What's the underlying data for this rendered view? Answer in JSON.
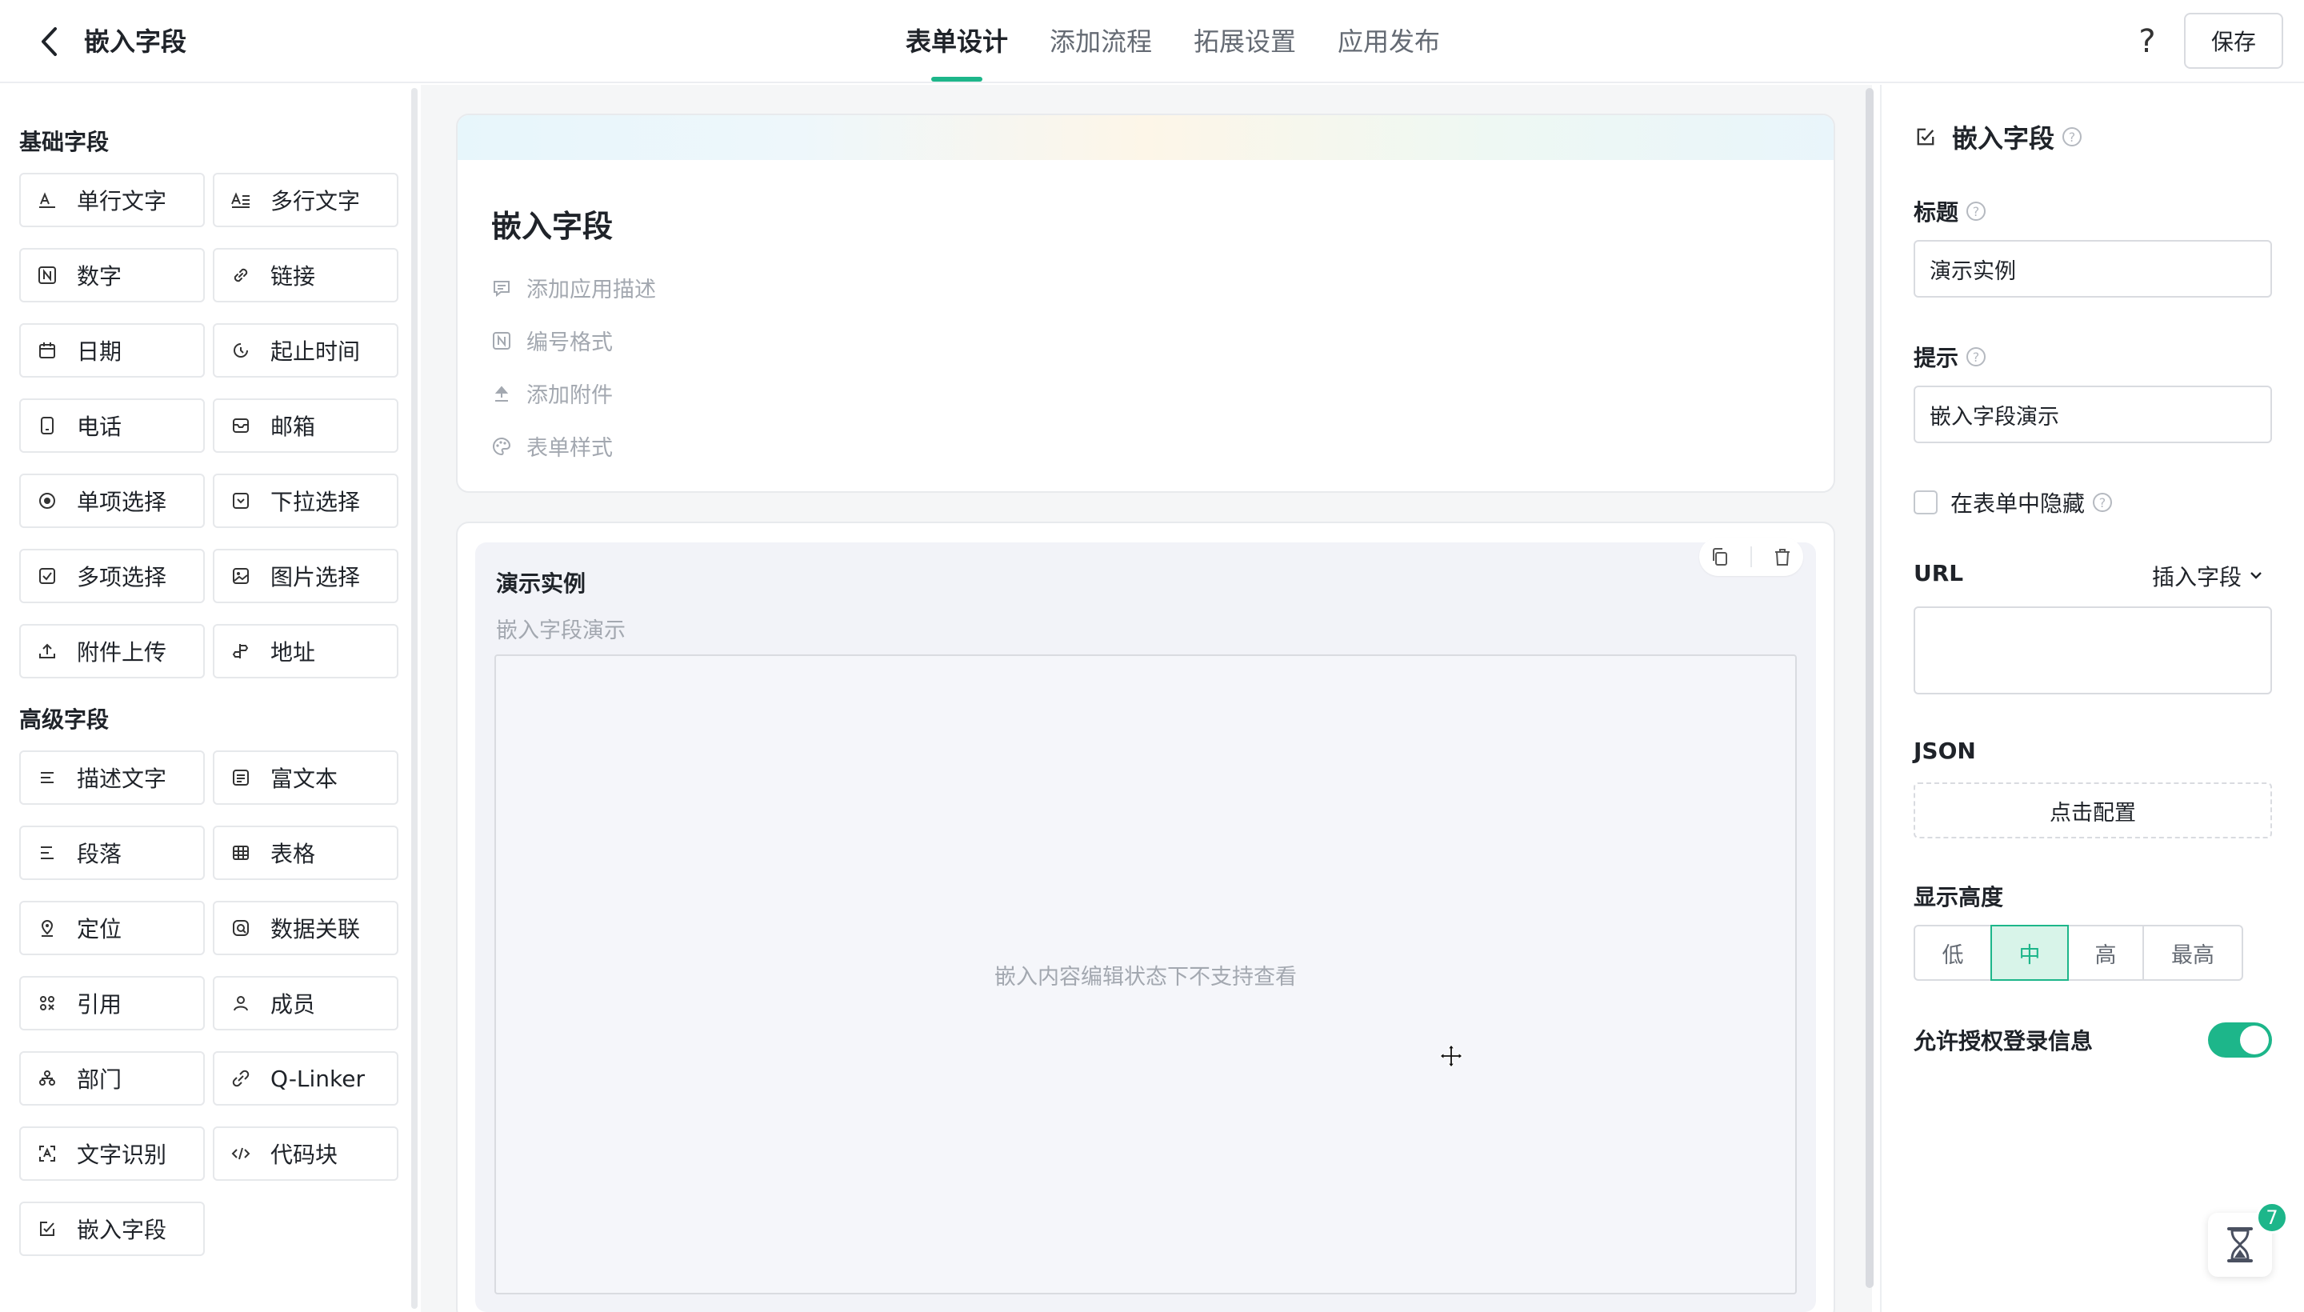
{
  "header": {
    "back_icon": "chevron-left-icon",
    "title": "嵌入字段",
    "tabs": [
      {
        "label": "表单设计",
        "active": true
      },
      {
        "label": "添加流程",
        "active": false
      },
      {
        "label": "拓展设置",
        "active": false
      },
      {
        "label": "应用发布",
        "active": false
      }
    ],
    "help_label": "?",
    "save_label": "保存"
  },
  "sidebar": {
    "basic_title": "基础字段",
    "basic_items": [
      {
        "label": "单行文字",
        "icon": "single-line-text-icon"
      },
      {
        "label": "多行文字",
        "icon": "multi-line-text-icon"
      },
      {
        "label": "数字",
        "icon": "number-icon"
      },
      {
        "label": "链接",
        "icon": "link-icon"
      },
      {
        "label": "日期",
        "icon": "calendar-icon"
      },
      {
        "label": "起止时间",
        "icon": "time-range-icon"
      },
      {
        "label": "电话",
        "icon": "phone-icon"
      },
      {
        "label": "邮箱",
        "icon": "email-icon"
      },
      {
        "label": "单项选择",
        "icon": "radio-icon"
      },
      {
        "label": "下拉选择",
        "icon": "dropdown-icon"
      },
      {
        "label": "多项选择",
        "icon": "checkbox-icon"
      },
      {
        "label": "图片选择",
        "icon": "image-icon"
      },
      {
        "label": "附件上传",
        "icon": "upload-icon"
      },
      {
        "label": "地址",
        "icon": "address-icon"
      }
    ],
    "advanced_title": "高级字段",
    "advanced_items": [
      {
        "label": "描述文字",
        "icon": "description-icon"
      },
      {
        "label": "富文本",
        "icon": "rich-text-icon"
      },
      {
        "label": "段落",
        "icon": "paragraph-icon"
      },
      {
        "label": "表格",
        "icon": "table-icon"
      },
      {
        "label": "定位",
        "icon": "location-icon"
      },
      {
        "label": "数据关联",
        "icon": "data-link-icon"
      },
      {
        "label": "引用",
        "icon": "reference-icon"
      },
      {
        "label": "成员",
        "icon": "member-icon"
      },
      {
        "label": "部门",
        "icon": "department-icon"
      },
      {
        "label": "Q-Linker",
        "icon": "q-linker-icon"
      },
      {
        "label": "文字识别",
        "icon": "ocr-icon"
      },
      {
        "label": "代码块",
        "icon": "code-icon"
      },
      {
        "label": "嵌入字段",
        "icon": "embed-icon"
      }
    ]
  },
  "form": {
    "title": "嵌入字段",
    "actions": [
      {
        "label": "添加应用描述",
        "icon": "comment-icon"
      },
      {
        "label": "编号格式",
        "icon": "number-format-icon"
      },
      {
        "label": "添加附件",
        "icon": "attachment-upload-icon"
      },
      {
        "label": "表单样式",
        "icon": "palette-icon"
      }
    ],
    "field": {
      "label": "演示实例",
      "hint": "嵌入字段演示",
      "placeholder_text": "嵌入内容编辑状态下不支持查看",
      "copy_icon": "copy-icon",
      "delete_icon": "trash-icon"
    }
  },
  "panel": {
    "title": "嵌入字段",
    "title_icon": "embed-icon",
    "help_mark": "?",
    "title_label": "标题",
    "title_value": "演示实例",
    "hint_label": "提示",
    "hint_value": "嵌入字段演示",
    "hide_label": "在表单中隐藏",
    "hide_checked": false,
    "url_label": "URL",
    "insert_field_label": "插入字段",
    "url_value": "",
    "json_label": "JSON",
    "config_label": "点击配置",
    "height_label": "显示高度",
    "height_options": [
      "低",
      "中",
      "高",
      "最高"
    ],
    "height_selected": "中",
    "auth_label": "允许授权登录信息",
    "auth_enabled": true,
    "float_badge": "7",
    "float_icon": "hourglass-icon"
  },
  "colors": {
    "accent": "#1db68a",
    "text": "#1f2329",
    "muted": "#a3a8b0",
    "border": "#d9dbe0",
    "canvas_bg": "#f5f6f7"
  }
}
